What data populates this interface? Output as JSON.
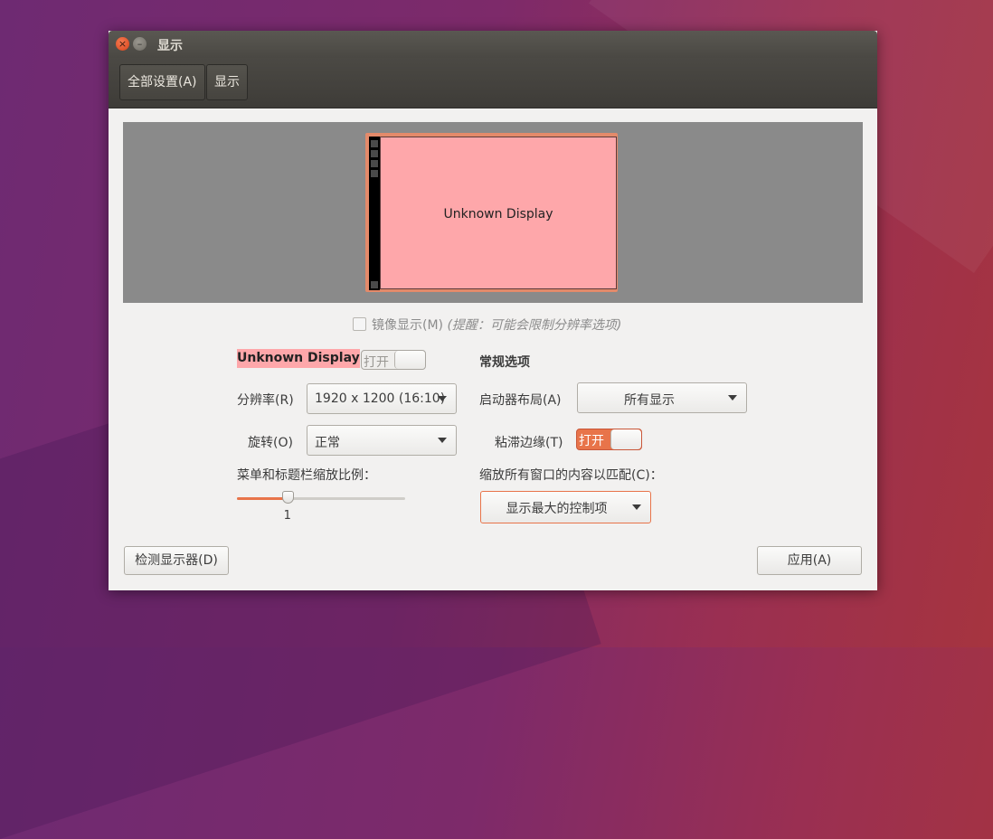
{
  "window": {
    "title": "显示"
  },
  "toolbar": {
    "all_settings": "全部设置(A)",
    "current": "显示"
  },
  "monitor": {
    "name": "Unknown Display"
  },
  "mirror": {
    "label": "镜像显示(M)",
    "hint": "(提醒：可能会限制分辨率选项)",
    "checked": false
  },
  "display": {
    "name": "Unknown Display",
    "power_toggle": "打开",
    "power_on": false,
    "resolution_label": "分辨率(R)",
    "resolution_value": "1920 x 1200 (16:10)",
    "rotation_label": "旋转(O)",
    "rotation_value": "正常",
    "scale_label": "菜单和标题栏缩放比例：",
    "scale_value": "1",
    "scale_fraction": 0.3
  },
  "general": {
    "title": "常规选项",
    "launcher_label": "启动器布局(A)",
    "launcher_value": "所有显示",
    "sticky_label": "粘滞边缘(T)",
    "sticky_toggle": "打开",
    "sticky_on": true,
    "fit_label": "缩放所有窗口的内容以匹配(C)：",
    "fit_value": "显示最大的控制项"
  },
  "buttons": {
    "detect": "检测显示器(D)",
    "apply": "应用(A)"
  },
  "colors": {
    "accent": "#e8744a",
    "monitor_fill": "#fea7aa"
  }
}
